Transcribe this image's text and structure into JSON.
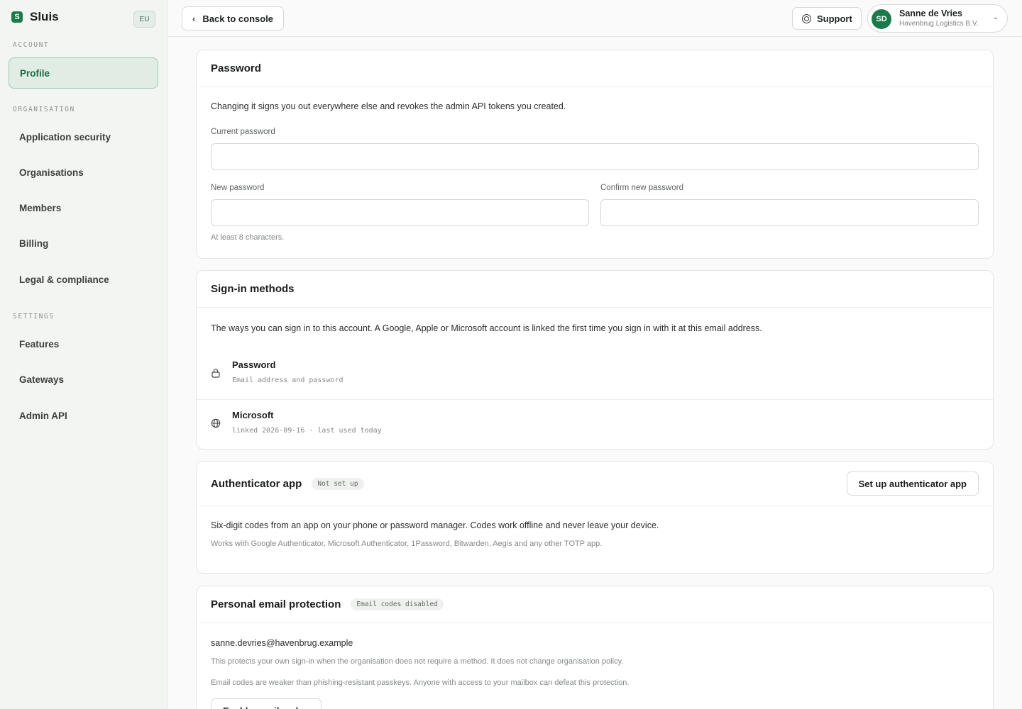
{
  "brand": {
    "name": "Sluis",
    "region": "EU"
  },
  "sidebar": {
    "sections": [
      {
        "label": "ACCOUNT",
        "items": [
          {
            "label": "Profile",
            "active": true
          }
        ]
      },
      {
        "label": "ORGANISATION",
        "items": [
          {
            "label": "Application security"
          },
          {
            "label": "Organisations"
          },
          {
            "label": "Members"
          },
          {
            "label": "Billing"
          },
          {
            "label": "Legal & compliance"
          }
        ]
      },
      {
        "label": "SETTINGS",
        "items": [
          {
            "label": "Features"
          },
          {
            "label": "Gateways"
          },
          {
            "label": "Admin API"
          }
        ]
      }
    ]
  },
  "topbar": {
    "back_label": "Back to console",
    "support_label": "Support",
    "user": {
      "initials": "SD",
      "name": "Sanne de Vries",
      "org": "Havenbrug Logistics B.V."
    }
  },
  "password": {
    "title": "Password",
    "description": "Changing it signs you out everywhere else and revokes the admin API tokens you created.",
    "current_label": "Current password",
    "current_value": "",
    "new_label": "New password",
    "new_value": "",
    "confirm_label": "Confirm new password",
    "confirm_value": "",
    "hint": "At least 8 characters."
  },
  "signin": {
    "title": "Sign-in methods",
    "description": "The ways you can sign in to this account. A Google, Apple or Microsoft account is linked the first time you sign in with it at this email address.",
    "methods": [
      {
        "icon": "lock-icon",
        "title": "Password",
        "subtitle": "Email address and password"
      },
      {
        "icon": "globe-icon",
        "title": "Microsoft",
        "subtitle": "linked 2026-09-16 · last used today"
      }
    ]
  },
  "authenticator": {
    "title": "Authenticator app",
    "status": "Not set up",
    "action_label": "Set up authenticator app",
    "description": "Six-digit codes from an app on your phone or password manager. Codes work offline and never leave your device.",
    "note": "Works with Google Authenticator, Microsoft Authenticator, 1Password, Bitwarden, Aegis and any other TOTP app."
  },
  "email_protection": {
    "title": "Personal email protection",
    "status": "Email codes disabled",
    "email": "sanne.devries@havenbrug.example",
    "note1": "This protects your own sign-in when the organisation does not require a method. It does not change organisation policy.",
    "note2": "Email codes are weaker than phishing-resistant passkeys. Anyone with access to your mailbox can defeat this protection.",
    "action_label": "Enable email codes"
  },
  "colors": {
    "accent": "#1c7a4a",
    "active_bg": "#e0ece4",
    "active_border": "#9fcab0"
  }
}
